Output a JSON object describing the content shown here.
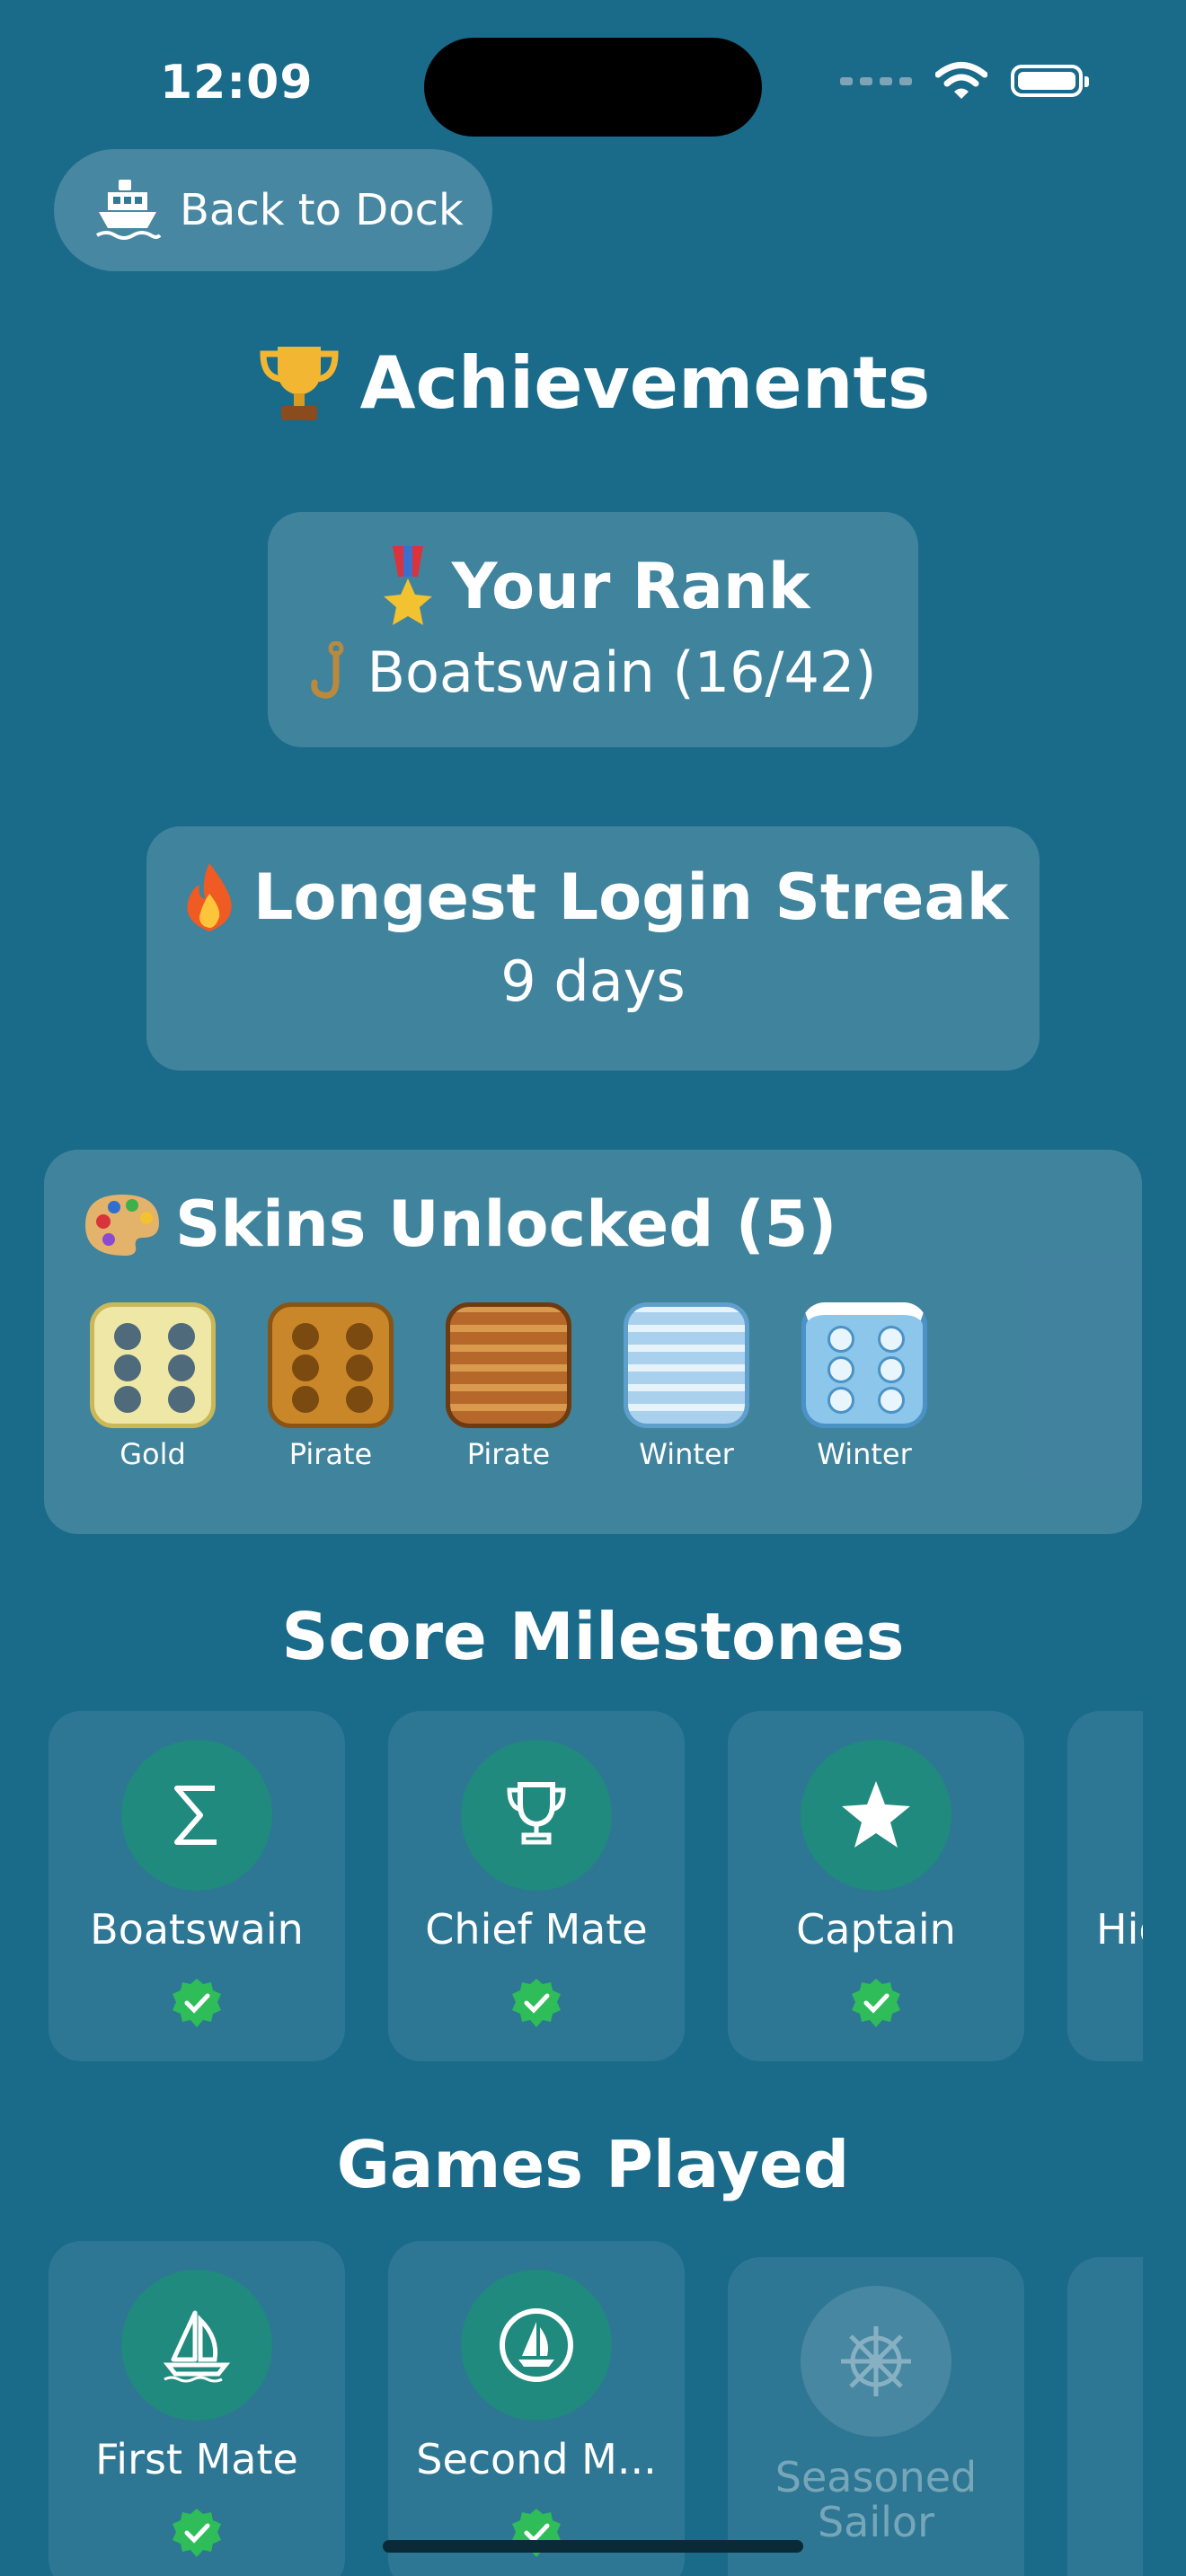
{
  "status": {
    "time": "12:09"
  },
  "nav": {
    "back_label": "Back to Dock"
  },
  "page": {
    "title": "Achievements"
  },
  "rank": {
    "heading": "Your Rank",
    "value": "Boatswain (16/42)"
  },
  "streak": {
    "heading": "Longest Login Streak",
    "value": "9 days"
  },
  "skins": {
    "heading": "Skins Unlocked (5)",
    "items": [
      {
        "label": "Gold"
      },
      {
        "label": "Pirate"
      },
      {
        "label": "Pirate"
      },
      {
        "label": "Winter"
      },
      {
        "label": "Winter"
      }
    ]
  },
  "score_milestones": {
    "title": "Score Milestones",
    "items": [
      {
        "name": "Boatswain",
        "icon": "sigma-icon",
        "achieved": true
      },
      {
        "name": "Chief Mate",
        "icon": "trophy-icon",
        "achieved": true
      },
      {
        "name": "Captain",
        "icon": "star-icon",
        "achieved": true
      },
      {
        "name": "Hig",
        "icon": "",
        "achieved": true
      }
    ]
  },
  "games_played": {
    "title": "Games Played",
    "items": [
      {
        "name": "First Mate",
        "icon": "sailboat-icon",
        "achieved": true
      },
      {
        "name": "Second M...",
        "icon": "sailboat-circle-icon",
        "achieved": true
      },
      {
        "name_line1": "Seasoned",
        "name_line2": "Sailor",
        "icon": "ship-wheel-icon",
        "achieved": false
      }
    ]
  },
  "colors": {
    "background": "#1a6a8a",
    "accent": "#1f8a7d",
    "check": "#2ebd59"
  }
}
